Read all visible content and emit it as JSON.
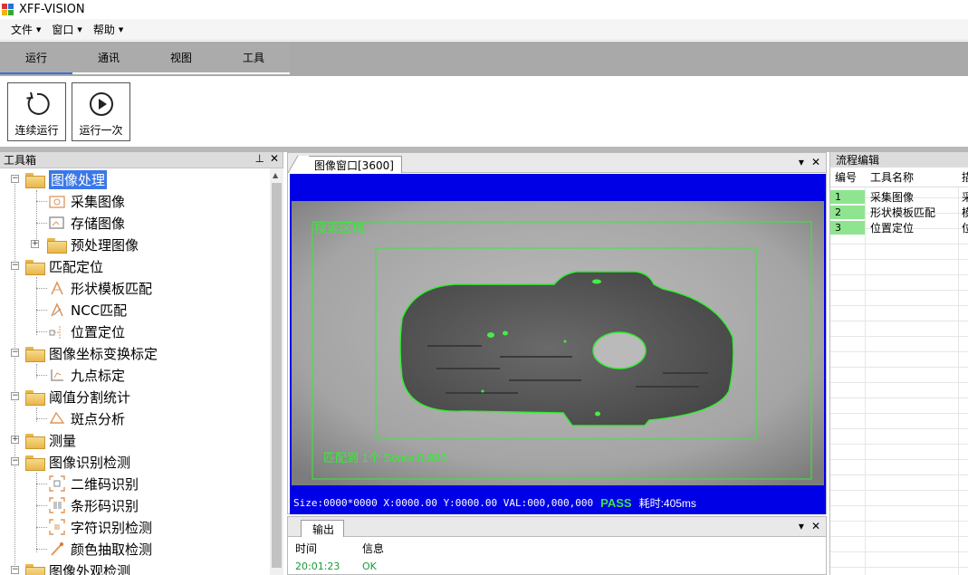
{
  "app": {
    "title": "XFF-VISION"
  },
  "menu": [
    {
      "label": "文件"
    },
    {
      "label": "窗口"
    },
    {
      "label": "帮助"
    }
  ],
  "ribbon": {
    "tabs": [
      {
        "label": "运行",
        "active": true
      },
      {
        "label": "通讯"
      },
      {
        "label": "视图"
      },
      {
        "label": "工具"
      }
    ],
    "buttons": [
      {
        "label": "连续运行",
        "icon": "refresh-icon"
      },
      {
        "label": "运行一次",
        "icon": "play-icon"
      }
    ]
  },
  "toolbox": {
    "title": "工具箱",
    "items": [
      {
        "label": "图像处理",
        "type": "folder",
        "level": 0,
        "expanded": true,
        "selected": true
      },
      {
        "label": "采集图像",
        "type": "tool",
        "level": 1,
        "icon": "camera-icon"
      },
      {
        "label": "存储图像",
        "type": "tool",
        "level": 1,
        "icon": "save-image-icon"
      },
      {
        "label": "预处理图像",
        "type": "folder",
        "level": 1,
        "expanded": false
      },
      {
        "label": "匹配定位",
        "type": "folder",
        "level": 0,
        "expanded": true
      },
      {
        "label": "形状模板匹配",
        "type": "tool",
        "level": 1,
        "icon": "shape-match-icon"
      },
      {
        "label": "NCC匹配",
        "type": "tool",
        "level": 1,
        "icon": "ncc-match-icon"
      },
      {
        "label": "位置定位",
        "type": "tool",
        "level": 1,
        "icon": "position-icon"
      },
      {
        "label": "图像坐标变换标定",
        "type": "folder",
        "level": 0,
        "expanded": true
      },
      {
        "label": "九点标定",
        "type": "tool",
        "level": 1,
        "icon": "calibration-icon"
      },
      {
        "label": "阈值分割统计",
        "type": "folder",
        "level": 0,
        "expanded": true
      },
      {
        "label": "斑点分析",
        "type": "tool",
        "level": 1,
        "icon": "blob-icon"
      },
      {
        "label": "测量",
        "type": "folder",
        "level": 0,
        "expanded": false
      },
      {
        "label": "图像识别检测",
        "type": "folder",
        "level": 0,
        "expanded": true
      },
      {
        "label": "二维码识别",
        "type": "tool",
        "level": 1,
        "icon": "qrcode-icon"
      },
      {
        "label": "条形码识别",
        "type": "tool",
        "level": 1,
        "icon": "barcode-icon"
      },
      {
        "label": "字符识别检测",
        "type": "tool",
        "level": 1,
        "icon": "ocr-icon"
      },
      {
        "label": "颜色抽取检测",
        "type": "tool",
        "level": 1,
        "icon": "color-picker-icon"
      },
      {
        "label": "图像外观检测",
        "type": "folder",
        "level": 0,
        "expanded": true
      }
    ]
  },
  "image_window": {
    "tab_label": "图像窗口[3600]",
    "overlay": {
      "search_label": "搜索区域",
      "match_label": "匹配到 1个 Score:0.980"
    },
    "status": {
      "info": "Size:0000*0000  X:0000.00  Y:0000.00  VAL:000,000,000",
      "result": "PASS",
      "elapsed": "耗时:405ms"
    }
  },
  "output": {
    "tab_label": "输出",
    "headers": {
      "time": "时间",
      "info": "信息"
    },
    "rows": [
      {
        "time": "20:01:23",
        "info": "OK"
      }
    ]
  },
  "flow_editor": {
    "title": "流程编辑",
    "headers": {
      "num": "编号",
      "name": "工具名称",
      "extra": "描"
    },
    "rows": [
      {
        "num": "1",
        "name": "采集图像",
        "extra": "采"
      },
      {
        "num": "2",
        "name": "形状模板匹配",
        "extra": "模"
      },
      {
        "num": "3",
        "name": "位置定位",
        "extra": "位"
      }
    ]
  },
  "colors": {
    "selection": "#3b78e7",
    "image_background": "#0000e6",
    "overlay_green": "#33ee33",
    "pass_green": "#44dd55",
    "flow_row_green": "#8fe58f"
  }
}
